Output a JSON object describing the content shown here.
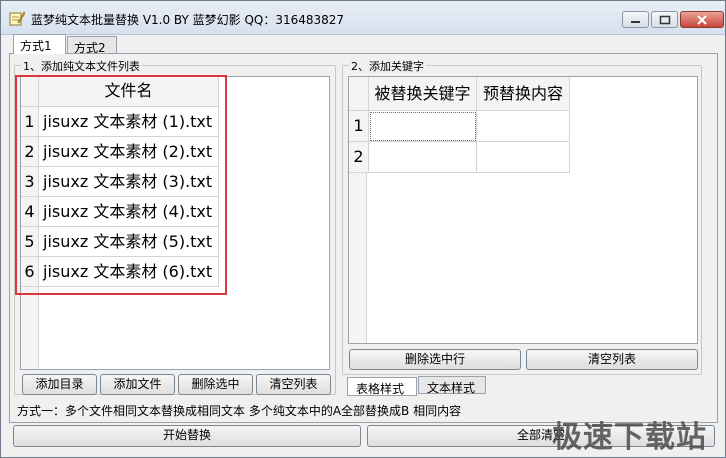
{
  "window": {
    "title": "蓝梦纯文本批量替换 V1.0 BY 蓝梦幻影 QQ：316483827"
  },
  "tabs": [
    {
      "label": "方式1"
    },
    {
      "label": "方式2"
    }
  ],
  "left_panel": {
    "group_label": "1、添加纯文本文件列表",
    "grid": {
      "column_header": "文件名",
      "rows": [
        {
          "index": "1",
          "file": "jisuxz 文本素材 (1).txt"
        },
        {
          "index": "2",
          "file": "jisuxz 文本素材 (2).txt"
        },
        {
          "index": "3",
          "file": "jisuxz 文本素材 (3).txt"
        },
        {
          "index": "4",
          "file": "jisuxz 文本素材 (4).txt"
        },
        {
          "index": "5",
          "file": "jisuxz 文本素材 (5).txt"
        },
        {
          "index": "6",
          "file": "jisuxz 文本素材 (6).txt"
        }
      ]
    },
    "buttons": [
      "添加目录",
      "添加文件",
      "删除选中",
      "清空列表"
    ]
  },
  "right_panel": {
    "group_label": "2、添加关键字",
    "grid": {
      "headers": [
        "被替换关键字",
        "预替换内容"
      ],
      "row_numbers": [
        "1",
        "2"
      ]
    },
    "buttons": [
      "删除选中行",
      "清空列表"
    ],
    "subtabs": [
      "表格样式",
      "文本样式"
    ]
  },
  "note": "方式一：多个文件相同文本替换成相同文本   多个纯文本中的A全部替换成B 相同内容",
  "bottom_buttons": {
    "start": "开始替换",
    "clear_all": "全部清空"
  },
  "watermark": "极速下载站"
}
